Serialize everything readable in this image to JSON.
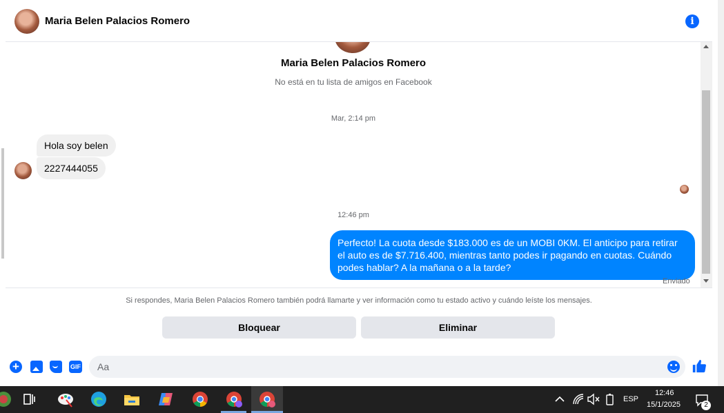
{
  "header": {
    "contact_name": "Maria Belen Palacios Romero",
    "icons": {
      "avatar": "avatar",
      "info": "info-icon"
    },
    "info_glyph": "i"
  },
  "profile": {
    "name": "Maria Belen Palacios Romero",
    "subtitle": "No está en tu lista de amigos en Facebook"
  },
  "messages": [
    {
      "type": "timestamp",
      "text": "Mar, 2:14 pm"
    },
    {
      "type": "incoming",
      "text": "Hola soy belen"
    },
    {
      "type": "incoming",
      "text": "2227444055"
    },
    {
      "type": "timestamp",
      "text": "12:46 pm"
    },
    {
      "type": "outgoing",
      "text": "Perfecto! La cuota desde $183.000 es de un MOBI 0KM. El anticipo para retirar el auto es de $7.716.400, mientras tanto podes ir pagando en cuotas. Cuándo podes hablar? A la mañana o a la tarde?",
      "status": "Enviado"
    }
  ],
  "notice": "Si respondes, Maria Belen Palacios Romero también podrá llamarte y ver información como tu estado activo y cuándo leíste los mensajes.",
  "actions": {
    "block_label": "Bloquear",
    "delete_label": "Eliminar"
  },
  "composer": {
    "placeholder": "Aa",
    "value": "",
    "plus_glyph": "+",
    "gif_label": "GIF",
    "icons": [
      "plus-icon",
      "photo-icon",
      "sticker-icon",
      "gif-icon",
      "emoji-icon",
      "thumbs-up-icon"
    ]
  },
  "colors": {
    "accent": "#0866ff",
    "outgoing_bubble": "#0084ff",
    "incoming_bubble": "#f0f0f0",
    "taskbar": "#202020"
  },
  "taskbar": {
    "apps": [
      "copilot-icon",
      "task-view-icon",
      "paint-icon",
      "edge-icon",
      "file-explorer-icon",
      "copilot-app-icon",
      "chrome-icon",
      "chrome-profile-icon",
      "chrome-profile-active-icon"
    ],
    "tray": {
      "language": "ESP",
      "time": "12:46",
      "date": "15/1/2025",
      "notifications": "2"
    }
  }
}
